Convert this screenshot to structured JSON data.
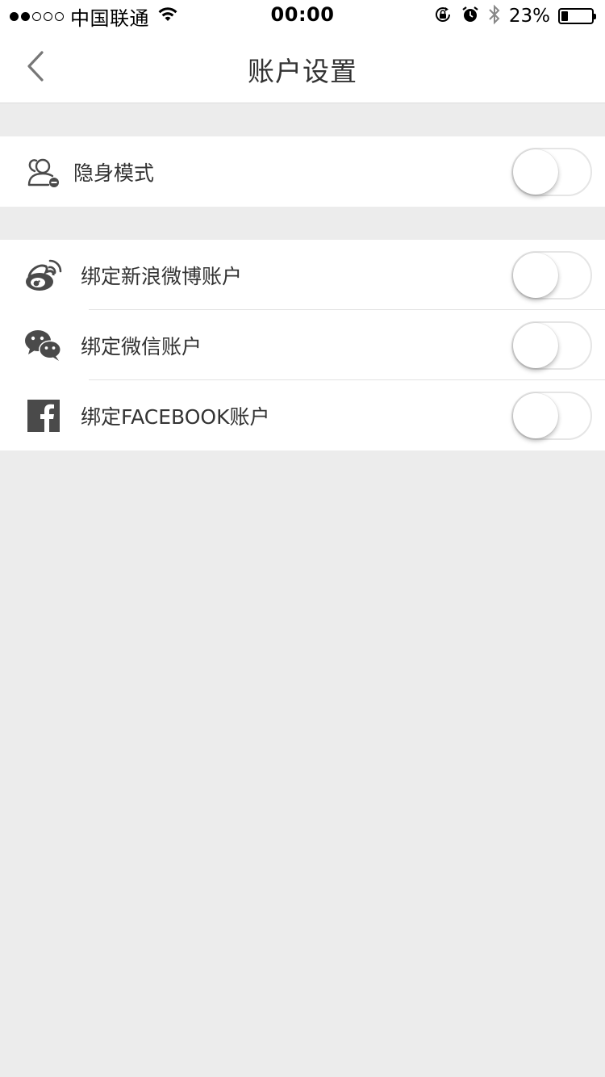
{
  "status_bar": {
    "signal_bars": [
      true,
      true,
      false,
      false,
      false
    ],
    "carrier": "中国联通",
    "time": "00:00",
    "battery_percent": "23%",
    "battery_level": 0.23,
    "icons": [
      "wifi-icon",
      "orientation-lock-icon",
      "alarm-icon",
      "bluetooth-icon",
      "battery-icon"
    ]
  },
  "nav": {
    "back_icon": "chevron-left-icon",
    "title": "账户设置"
  },
  "settings": {
    "invisible": {
      "icon": "invisible-user-icon",
      "label": "隐身模式",
      "enabled": false
    },
    "bindings": [
      {
        "icon": "weibo-icon",
        "label": "绑定新浪微博账户",
        "enabled": false
      },
      {
        "icon": "wechat-icon",
        "label": "绑定微信账户",
        "enabled": false
      },
      {
        "icon": "facebook-icon",
        "label": "绑定FACEBOOK账户",
        "enabled": false
      }
    ]
  },
  "colors": {
    "background": "#ececec",
    "card": "#ffffff",
    "text": "#333333",
    "icon": "#4a4a4a"
  }
}
